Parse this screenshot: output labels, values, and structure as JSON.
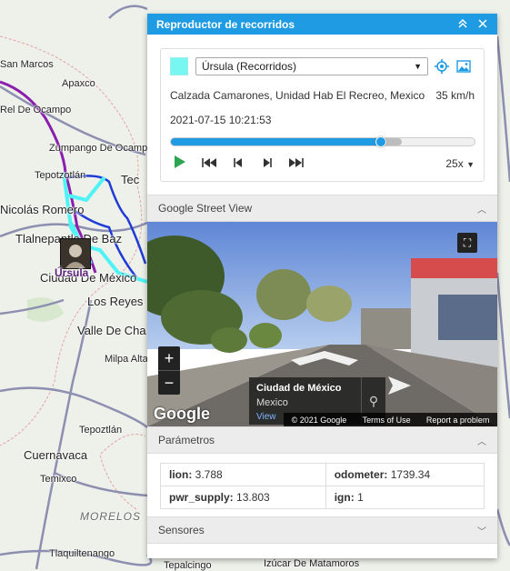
{
  "map": {
    "labels": [
      "San Marcos",
      "Apaxco",
      "Rel De Ocampo",
      "Zumpango De Ocamp",
      "Tepotzotlán",
      "Tec",
      "Nicolás Romero",
      "Tlalnepantla De Baz",
      "Ciudad De México",
      "Los Reyes",
      "Valle De Cha",
      "Milpa Alta",
      "Tepoztlán",
      "Cuernavaca",
      "Temixco",
      "MORELOS",
      "Tlaquiltenango",
      "Tepalcingo",
      "Izúcar De Matamoros"
    ],
    "marker_label": "Úrsula"
  },
  "panel": {
    "title": "Reproductor de recorridos",
    "collapse_icon": "double-chevron-up-icon",
    "close_icon": "close-icon",
    "player": {
      "swatch_color": "#78f6f2",
      "track_select": "Úrsula (Recorridos)",
      "address": "Calzada Camarones, Unidad Hab El Recreo, Mexico",
      "speed": "35 km/h",
      "datetime": "2021-07-15 10:21:53",
      "progress_fraction": 0.69,
      "buffer_fraction": 0.76,
      "playback_speed": "25x",
      "controls": [
        "play",
        "skip-start",
        "step-back",
        "step-forward",
        "skip-end"
      ]
    },
    "street_view": {
      "section_title": "Google Street View",
      "place": "Ciudad de México",
      "country": "Mexico",
      "view_link": "View",
      "google_logo": "Google",
      "copyright": "© 2021 Google",
      "terms": "Terms of Use",
      "report": "Report a problem",
      "zoom_in": "+",
      "zoom_out": "−"
    },
    "parameters": {
      "section_title": "Parámetros",
      "rows": [
        [
          {
            "name": "lion:",
            "value": "3.788"
          },
          {
            "name": "odometer:",
            "value": "1739.34"
          }
        ],
        [
          {
            "name": "pwr_supply:",
            "value": "13.803"
          },
          {
            "name": "ign:",
            "value": "1"
          }
        ]
      ]
    },
    "sensors": {
      "section_title": "Sensores"
    },
    "colors": {
      "header": "#1f9be3",
      "accent": "#1f9be3",
      "play": "#2ea44f"
    }
  }
}
